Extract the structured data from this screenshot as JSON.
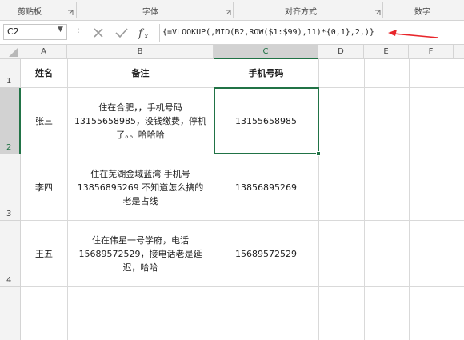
{
  "ribbon": {
    "groups": [
      "剪贴板",
      "字体",
      "对齐方式",
      "数字"
    ]
  },
  "formula_bar": {
    "name_box": "C2",
    "separator": ":",
    "formula": "{=VLOOKUP(,MID(B2,ROW($1:$99),11)*{0,1},2,)}",
    "annotation_color": "#e8262b"
  },
  "columns": [
    "A",
    "B",
    "C",
    "D",
    "E",
    "F"
  ],
  "rows": [
    "1",
    "2",
    "3",
    "4"
  ],
  "sheet": {
    "header": {
      "a": "姓名",
      "b": "备注",
      "c": "手机号码"
    },
    "data": [
      {
        "name": "张三",
        "note": "住在合肥，，手机号码\n13155658985，没钱缴费，停机\n了。。哈哈哈",
        "phone": "13155658985"
      },
      {
        "name": "李四",
        "note": "住在芜湖金域蓝湾 手机号\n13856895269 不知道怎么搞的\n老是占线",
        "phone": "13856895269"
      },
      {
        "name": "王五",
        "note": "住在伟星一号学府，电话\n15689572529，接电话老是延\n迟，哈哈",
        "phone": "15689572529"
      }
    ]
  },
  "selection": {
    "cell": "C2",
    "color": "#217346"
  }
}
